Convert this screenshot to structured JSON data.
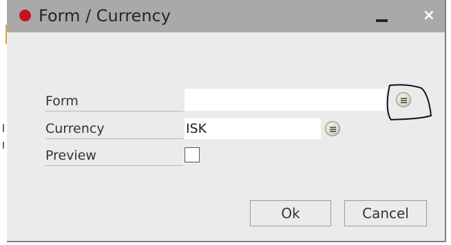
{
  "window": {
    "title": "Form / Currency",
    "minimize_glyph": "_",
    "close_glyph": "×",
    "status_dot_color": "#c4121f"
  },
  "fields": {
    "form": {
      "label": "Form",
      "value": ""
    },
    "currency": {
      "label": "Currency",
      "value": "ISK"
    },
    "preview": {
      "label": "Preview",
      "checked": false
    }
  },
  "buttons": {
    "ok": "Ok",
    "cancel": "Cancel"
  },
  "icons": {
    "lookup": "list-lookup-icon"
  }
}
